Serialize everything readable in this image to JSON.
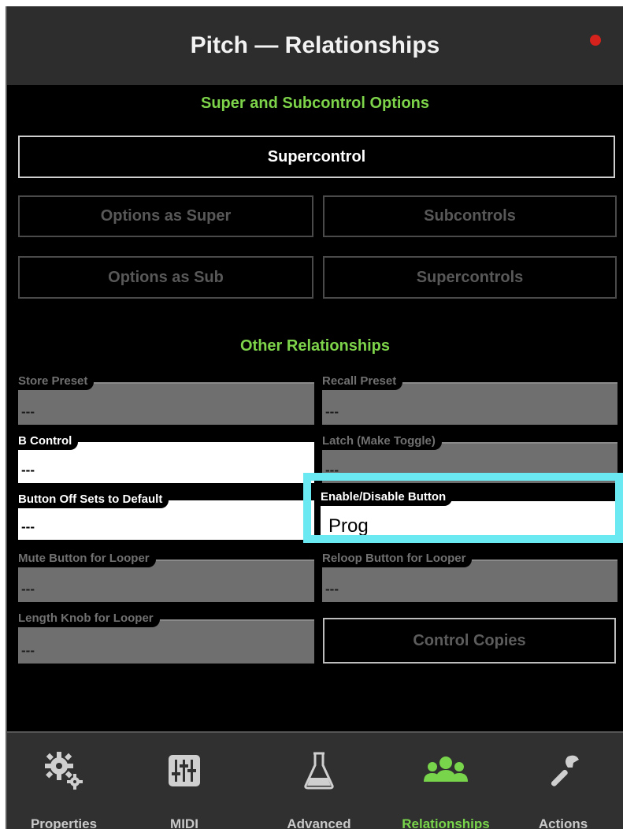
{
  "window": {
    "title": "Pitch — Relationships"
  },
  "super_section": {
    "heading": "Super and Subcontrol Options",
    "supercontrol_label": "Supercontrol",
    "options_as_super_label": "Options as Super",
    "subcontrols_label": "Subcontrols",
    "options_as_sub_label": "Options as Sub",
    "supercontrols_label": "Supercontrols"
  },
  "other_section": {
    "heading": "Other Relationships",
    "fields": {
      "store_preset": {
        "label": "Store Preset",
        "value": "---"
      },
      "recall_preset": {
        "label": "Recall Preset",
        "value": "---"
      },
      "b_control": {
        "label": "B Control",
        "value": "---"
      },
      "latch": {
        "label": "Latch (Make Toggle)",
        "value": "---"
      },
      "button_off_default": {
        "label": "Button Off Sets to Default",
        "value": "---"
      },
      "enable_disable": {
        "label": "Enable/Disable Button",
        "value": "Prog"
      },
      "mute_looper": {
        "label": "Mute Button for Looper",
        "value": "---"
      },
      "reloop_looper": {
        "label": "Reloop Button for Looper",
        "value": "---"
      },
      "length_looper": {
        "label": "Length Knob for Looper",
        "value": "---"
      }
    },
    "control_copies_label": "Control Copies"
  },
  "tabs": [
    {
      "label": "Properties",
      "icon": "gear-icon"
    },
    {
      "label": "MIDI",
      "icon": "mixer-sliders-icon"
    },
    {
      "label": "Advanced",
      "icon": "flask-icon"
    },
    {
      "label": "Relationships",
      "icon": "people-icon"
    },
    {
      "label": "Actions",
      "icon": "wrench-icon"
    }
  ],
  "colors": {
    "accent_green": "#7dd349",
    "highlight_cyan": "#6ae9f2",
    "record_red": "#d6221c"
  }
}
